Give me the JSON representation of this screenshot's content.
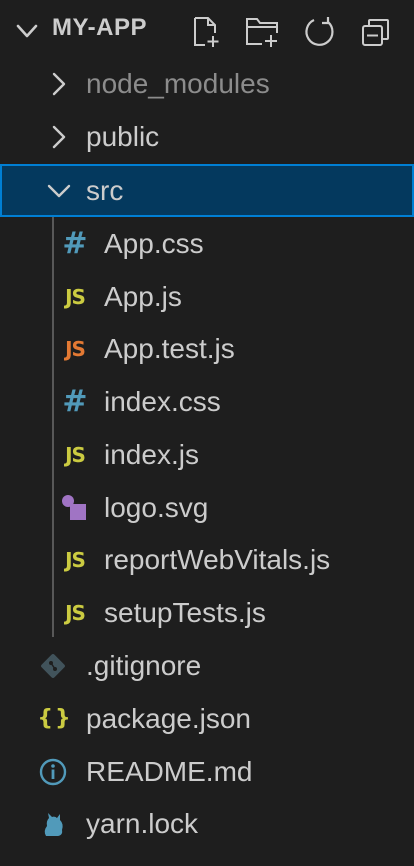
{
  "explorer": {
    "title": "MY-APP",
    "toolbar": {
      "new_file": "new-file-icon",
      "new_folder": "new-folder-icon",
      "refresh": "refresh-icon",
      "collapse_all": "collapse-all-icon"
    }
  },
  "tree": {
    "node_modules": "node_modules",
    "public": "public",
    "src": "src",
    "src_files": [
      {
        "name": "App.css",
        "icon": "css-icon"
      },
      {
        "name": "App.js",
        "icon": "js-icon"
      },
      {
        "name": "App.test.js",
        "icon": "js-test-icon"
      },
      {
        "name": "index.css",
        "icon": "css-icon"
      },
      {
        "name": "index.js",
        "icon": "js-icon"
      },
      {
        "name": "logo.svg",
        "icon": "svg-icon"
      },
      {
        "name": "reportWebVitals.js",
        "icon": "js-icon"
      },
      {
        "name": "setupTests.js",
        "icon": "js-icon"
      }
    ],
    "root_files": [
      {
        "name": ".gitignore",
        "icon": "git-icon"
      },
      {
        "name": "package.json",
        "icon": "json-icon"
      },
      {
        "name": "README.md",
        "icon": "info-icon"
      },
      {
        "name": "yarn.lock",
        "icon": "yarn-icon"
      }
    ]
  },
  "icon_text": {
    "js": "JS",
    "css": "#",
    "json": "{}"
  },
  "colors": {
    "background": "#1e1e1e",
    "selection": "#04395e",
    "selection_border": "#007fd4",
    "js": "#cbcb41",
    "js_test": "#e37933",
    "css": "#519aba",
    "svg": "#a074c4",
    "git": "#41535b",
    "info": "#519aba",
    "yarn": "#519aba"
  }
}
